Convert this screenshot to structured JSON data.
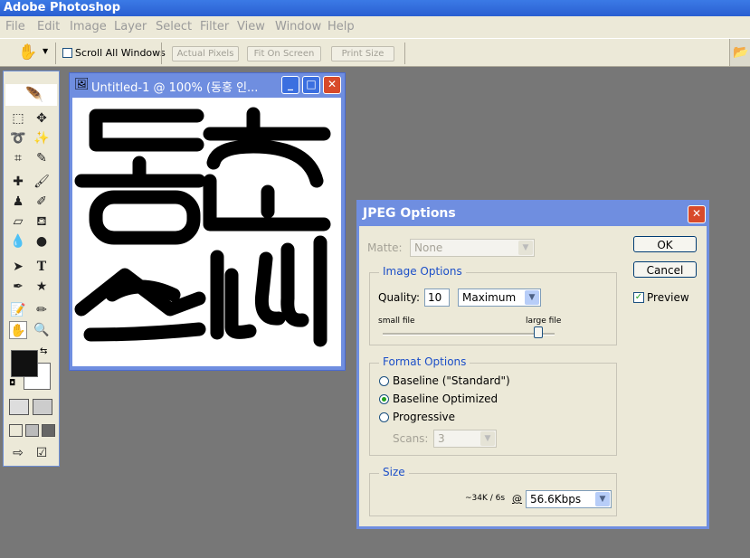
{
  "app": {
    "title": "Adobe Photoshop"
  },
  "menu": [
    "File",
    "Edit",
    "Image",
    "Layer",
    "Select",
    "Filter",
    "View",
    "Window",
    "Help"
  ],
  "options_bar": {
    "scroll_all_windows": "Scroll All Windows",
    "actual_pixels": "Actual Pixels",
    "fit_on_screen": "Fit On Screen",
    "print_size": "Print Size"
  },
  "document": {
    "title": "Untitled-1 @ 100% (동홍 인..."
  },
  "dialog": {
    "title": "JPEG Options",
    "matte_label": "Matte:",
    "matte_value": "None",
    "ok": "OK",
    "cancel": "Cancel",
    "preview": "Preview",
    "image_options": {
      "group": "Image Options",
      "quality_label": "Quality:",
      "quality_value": "10",
      "quality_preset": "Maximum",
      "small_file": "small file",
      "large_file": "large file",
      "slider_level": 0.9
    },
    "format_options": {
      "group": "Format Options",
      "baseline_standard": "Baseline (\"Standard\")",
      "baseline_optimized": "Baseline Optimized",
      "progressive": "Progressive",
      "scans_label": "Scans:",
      "scans_value": "3",
      "selected": "Baseline Optimized"
    },
    "size": {
      "group": "Size",
      "estimate": "~34K / 6s",
      "at": "@",
      "speed": "56.6Kbps"
    }
  }
}
